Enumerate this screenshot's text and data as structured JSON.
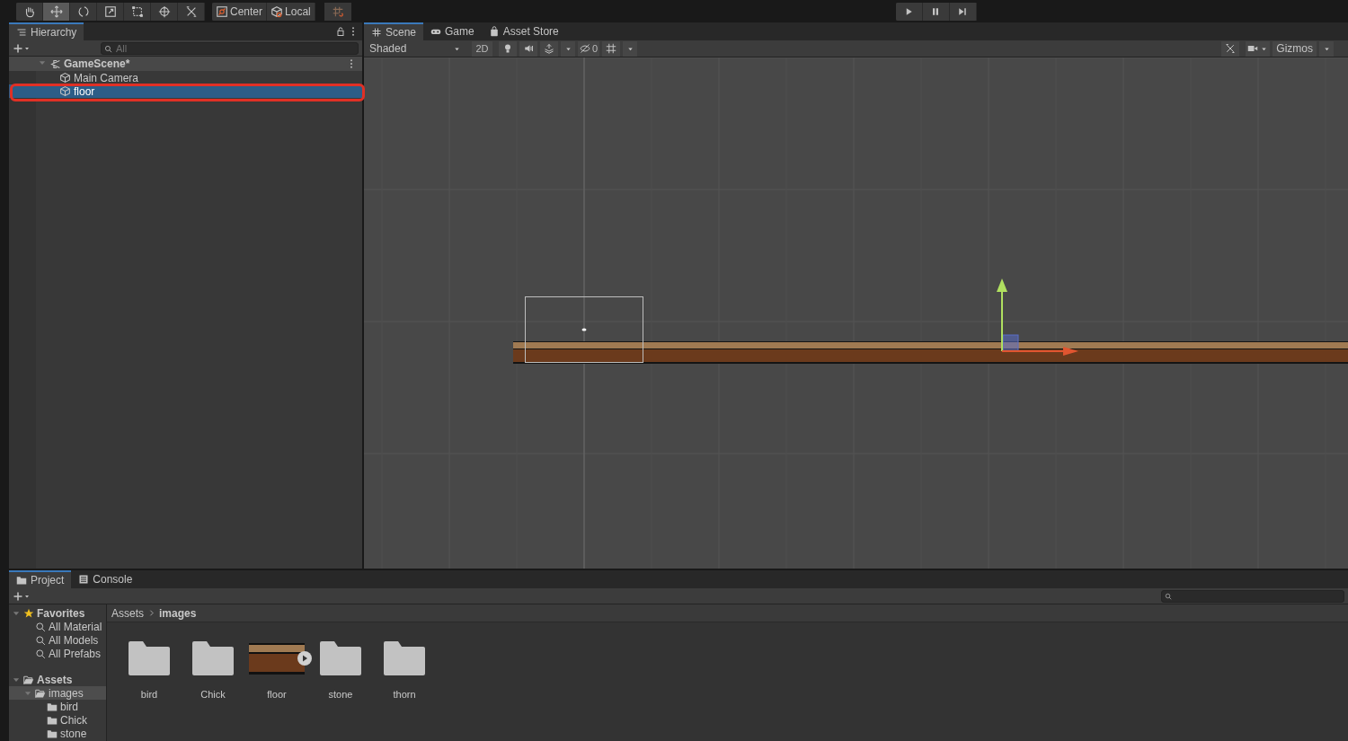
{
  "toolbar": {
    "tools": [
      {
        "kind": "hand",
        "selected": false
      },
      {
        "kind": "move",
        "selected": true
      },
      {
        "kind": "rotate",
        "selected": false
      },
      {
        "kind": "scale",
        "selected": false
      },
      {
        "kind": "rect",
        "selected": false
      },
      {
        "kind": "transform",
        "selected": false
      },
      {
        "kind": "custom",
        "selected": false
      }
    ],
    "pivot_buttons": [
      {
        "kind": "pivot",
        "label": "Center"
      },
      {
        "kind": "space",
        "label": "Local"
      }
    ],
    "play_controls": [
      {
        "kind": "play"
      },
      {
        "kind": "pause"
      },
      {
        "kind": "step"
      }
    ]
  },
  "hierarchy": {
    "tab": "Hierarchy",
    "search": {
      "placeholder": "All"
    },
    "scene": {
      "name": "GameScene*",
      "expanded": true,
      "selected": false,
      "children": [
        {
          "name": "Main Camera",
          "selected": false,
          "outlined": false
        },
        {
          "name": "floor",
          "selected": true,
          "outlined": true
        }
      ]
    }
  },
  "scene_view": {
    "tabs": [
      {
        "label": "Scene",
        "kind": "scene",
        "selected": true
      },
      {
        "label": "Game",
        "kind": "game",
        "selected": false
      },
      {
        "label": "Asset Store",
        "kind": "store",
        "selected": false
      }
    ],
    "shading": "Shaded",
    "toggle_2d": {
      "label": "2D",
      "on": false
    },
    "hidden_count": "0",
    "gizmos": "Gizmos"
  },
  "project": {
    "tabs": [
      {
        "label": "Project",
        "kind": "project",
        "selected": true
      },
      {
        "label": "Console",
        "kind": "console",
        "selected": false
      }
    ],
    "tree": [
      {
        "label": "Favorites",
        "kind": "favorites",
        "expanded": true,
        "selected": false,
        "children": [
          {
            "label": "All Material",
            "kind": "search",
            "selected": false
          },
          {
            "label": "All Models",
            "kind": "search",
            "selected": false
          },
          {
            "label": "All Prefabs",
            "kind": "search",
            "selected": false
          }
        ]
      },
      {
        "label": "Assets",
        "kind": "folder",
        "expanded": true,
        "selected": false,
        "children": [
          {
            "label": "images",
            "kind": "folder",
            "expanded": true,
            "selected": true,
            "children": [
              {
                "label": "bird",
                "kind": "folder",
                "selected": false
              },
              {
                "label": "Chick",
                "kind": "folder",
                "selected": false
              },
              {
                "label": "stone",
                "kind": "folder",
                "selected": false
              }
            ]
          }
        ]
      }
    ],
    "breadcrumb": [
      "Assets",
      "images"
    ],
    "assets": [
      {
        "name": "bird",
        "kind": "folder"
      },
      {
        "name": "Chick",
        "kind": "folder"
      },
      {
        "name": "floor",
        "kind": "sprite"
      },
      {
        "name": "stone",
        "kind": "folder"
      },
      {
        "name": "thorn",
        "kind": "folder"
      }
    ]
  }
}
